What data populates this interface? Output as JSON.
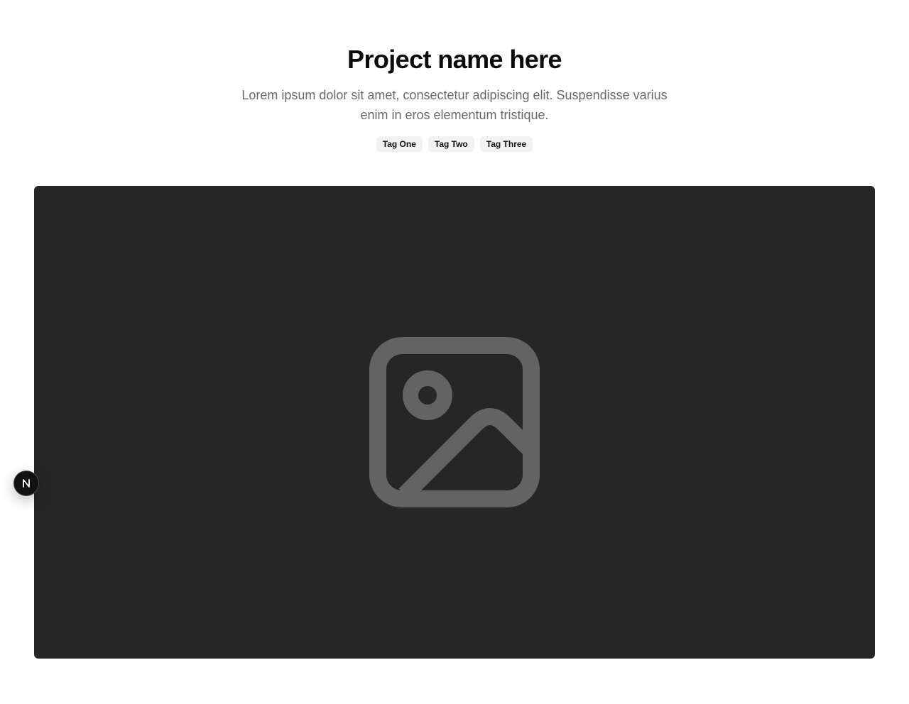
{
  "project": {
    "title": "Project name here",
    "description": "Lorem ipsum dolor sit amet, consectetur adipiscing elit. Suspendisse varius enim in eros elementum tristique.",
    "tags": [
      "Tag One",
      "Tag Two",
      "Tag Three"
    ]
  },
  "media": {
    "icon": "image-placeholder-icon",
    "background_color": "#262626",
    "icon_color": "#636363"
  },
  "dev_badge": {
    "icon": "nextjs-logo-icon",
    "letter": "N"
  },
  "colors": {
    "title": "#0b0b0b",
    "description": "#6a6a6a",
    "tag_background": "#f2f2f2"
  }
}
